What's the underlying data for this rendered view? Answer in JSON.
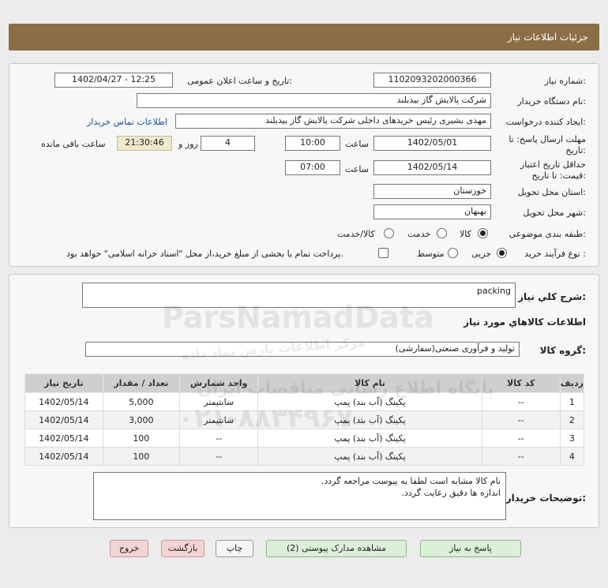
{
  "header": {
    "title": "جزئیات اطلاعات نیاز"
  },
  "form": {
    "need_number_label": "شماره نیاز:",
    "need_number": "1102093202000366",
    "announce_label": "تاریخ و ساعت اعلان عمومی:",
    "announce_value": "1402/04/27 - 12:25",
    "buyer_org_label": "نام دستگاه خریدار:",
    "buyer_org": "شرکت پالایش گاز بیدبلند",
    "requester_label": "ایجاد کننده درخواست:",
    "requester": "مهدی بشیری رئیس خریدهای داخلی شرکت پالایش گاز بیدبلند",
    "contact_link": "اطلاعات تماس خریدار",
    "deadline_label_1": "مهلت ارسال پاسخ: تا",
    "deadline_label_2": "تاریخ:",
    "deadline_date": "1402/05/01",
    "time_label": "ساعت",
    "deadline_time": "10:00",
    "days_value": "4",
    "days_label": "روز و",
    "remaining_time": "21:30:46",
    "remaining_label": "ساعت باقی مانده",
    "validity_label_1": "حداقل تاریخ اعتبار",
    "validity_label_2": "قیمت: تا تاریخ:",
    "validity_date": "1402/05/14",
    "validity_time_label": "ساعت",
    "validity_time": "07:00",
    "province_label": "استان محل تحویل:",
    "province": "خوزستان",
    "city_label": "شهر محل تحویل:",
    "city": "بهبهان",
    "category_label": "طبقه بندی موضوعی:",
    "category_options": [
      "کالا",
      "خدمت",
      "کالا/خدمت"
    ],
    "process_label": "نوع فرآیند خرید :",
    "process_options": [
      "جزیی",
      "متوسط"
    ],
    "payment_note": "پرداخت تمام یا بخشی از مبلغ خرید،از محل \"اسناد خزانه اسلامی\" خواهد بود."
  },
  "summary": {
    "label": "شرح کلي نياز:",
    "value": "packing",
    "goods_info_title": "اطلاعات کالاهاي مورد نياز",
    "group_label": "گروه کالا:",
    "group_value": "تولید و فرآوری صنعتی(سفارشی)"
  },
  "table": {
    "headers": [
      "ردیف",
      "کد کالا",
      "نام کالا",
      "واحد شمارش",
      "تعداد / مقدار",
      "تاریخ نیاز"
    ],
    "rows": [
      [
        "1",
        "--",
        "پکینگ (آب بند) پمپ",
        "سانتیمتر",
        "5,000",
        "1402/05/14"
      ],
      [
        "2",
        "--",
        "پکینگ (آب بند) پمپ",
        "سانتیمتر",
        "3,000",
        "1402/05/14"
      ],
      [
        "3",
        "--",
        "پکینگ (آب بند) پمپ",
        "--",
        "100",
        "1402/05/14"
      ],
      [
        "4",
        "--",
        "پکینگ (آب بند) پمپ",
        "--",
        "100",
        "1402/05/14"
      ]
    ]
  },
  "buyer_notes": {
    "label": "توضیحات خریدار:",
    "line1": "نام کالا مشابه است لطفا به پیوست مراجعه گردد.",
    "line2": "اندازه ها دقیق رعایت گردد."
  },
  "buttons": {
    "reply": "پاسخ به نیاز",
    "view_docs": "مشاهده مدارک پیوستی (2)",
    "print": "چاپ",
    "back": "بازگشت",
    "exit": "خروج"
  },
  "watermark": {
    "brand": "ParsNamadData",
    "phone": "۰۲۱-۸۸۳۴۹۶۷۰",
    "line1": "پایگاه اطلاع رسانی مناقصات ایران",
    "line2": "مرکز اطلاعات پارس نماد داده"
  }
}
